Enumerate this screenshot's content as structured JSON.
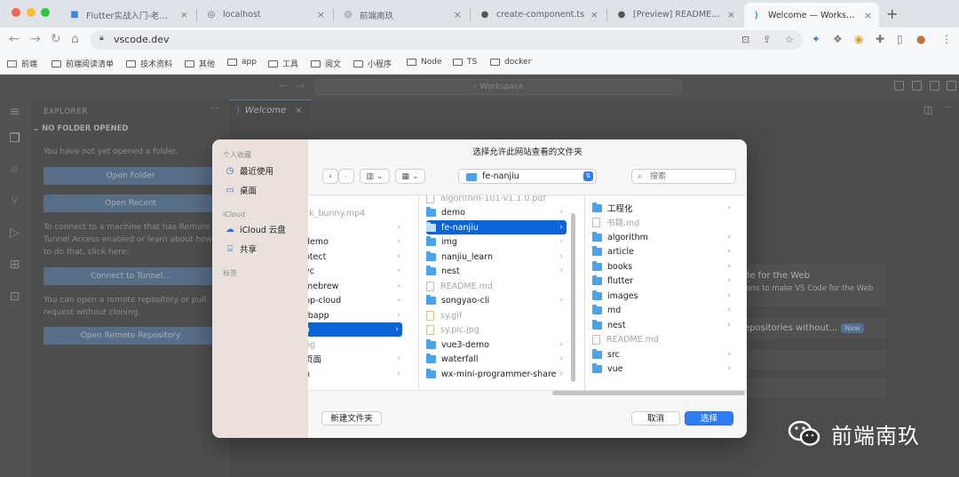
{
  "browser": {
    "tabs": [
      {
        "label": "Flutter实战入门-老孟-前端",
        "icon": "flutter-icon"
      },
      {
        "label": "localhost",
        "icon": "globe-icon"
      },
      {
        "label": "前端南玖",
        "icon": "globe-icon"
      },
      {
        "label": "create-component.ts",
        "icon": "github-icon"
      },
      {
        "label": "[Preview] README.md",
        "icon": "github-icon"
      },
      {
        "label": "Welcome — Workspace",
        "icon": "vscode-icon"
      }
    ],
    "address": "vscode.dev",
    "bookmarks": [
      "前端",
      "前端阅读清单",
      "技术资料",
      "其他",
      "app",
      "工具",
      "阅文",
      "小程序",
      "Node",
      "TS",
      "docker"
    ]
  },
  "vscode": {
    "command_center": "Workspace",
    "explorer_title": "EXPLORER",
    "no_folder_title": "NO FOLDER OPENED",
    "no_folder_text": "You have not yet opened a folder.",
    "open_folder": "Open Folder",
    "open_recent": "Open Recent",
    "tunnel_text": "To connect to a machine that has Remote Tunnel Access enabled or learn about how to do that, click here:",
    "connect_tunnel": "Connect to Tunnel...",
    "remote_text": "You can open a remote repository or pull request without cloning.",
    "open_remote": "Open Remote Repository",
    "welcome_tab": "Welcome",
    "card1_title": "de for the Web",
    "card1_text": "ions to make VS Code for the Web",
    "card2_title": "epositories without...",
    "new_badge": "New"
  },
  "dialog": {
    "title": "选择允许此网站查看的文件夹",
    "sidebar": {
      "favorites_header": "个人收藏",
      "recent": "最近使用",
      "desktop": "桌面",
      "icloud_header": "iCloud",
      "icloud_drive": "iCloud 云盘",
      "shared": "共享",
      "tags_header": "标签"
    },
    "path": "fe-nanjiu",
    "search_placeholder": "搜索",
    "columns": [
      [
        {
          "name": "ck_bunny.mp4",
          "kind": "file"
        },
        {
          "name": "",
          "kind": "folder"
        },
        {
          "name": "demo",
          "kind": "folder"
        },
        {
          "name": "otect",
          "kind": "folder"
        },
        {
          "name": "vc",
          "kind": "folder"
        },
        {
          "name": "mebrew",
          "kind": "folder"
        },
        {
          "name": "pp-cloud",
          "kind": "folder"
        },
        {
          "name": "tbapp",
          "kind": "folder"
        },
        {
          "name": "o",
          "kind": "folder",
          "selected": true
        },
        {
          "name": "ng",
          "kind": "file"
        },
        {
          "name": "页面",
          "kind": "folder"
        },
        {
          "name": "n",
          "kind": "folder"
        }
      ],
      [
        {
          "name": "algorithm-101-v1.1.0.pdf",
          "kind": "file"
        },
        {
          "name": "demo",
          "kind": "folder"
        },
        {
          "name": "fe-nanjiu",
          "kind": "folder",
          "selected": true
        },
        {
          "name": "img",
          "kind": "folder"
        },
        {
          "name": "nanjiu_learn",
          "kind": "folder"
        },
        {
          "name": "nest",
          "kind": "folder"
        },
        {
          "name": "README.md",
          "kind": "file"
        },
        {
          "name": "songyao-cli",
          "kind": "folder"
        },
        {
          "name": "sy.gif",
          "kind": "file"
        },
        {
          "name": "sy.pic.jpg",
          "kind": "file"
        },
        {
          "name": "vue3-demo",
          "kind": "folder"
        },
        {
          "name": "waterfall",
          "kind": "folder"
        },
        {
          "name": "wx-mini-programmer-share",
          "kind": "folder"
        }
      ],
      [
        {
          "name": "工程化",
          "kind": "folder"
        },
        {
          "name": "书籍.md",
          "kind": "file"
        },
        {
          "name": "algorithm",
          "kind": "folder"
        },
        {
          "name": "article",
          "kind": "folder"
        },
        {
          "name": "books",
          "kind": "folder"
        },
        {
          "name": "flutter",
          "kind": "folder"
        },
        {
          "name": "images",
          "kind": "folder"
        },
        {
          "name": "md",
          "kind": "folder"
        },
        {
          "name": "nest",
          "kind": "folder"
        },
        {
          "name": "README.md",
          "kind": "file"
        },
        {
          "name": "src",
          "kind": "folder"
        },
        {
          "name": "vue",
          "kind": "folder"
        }
      ]
    ],
    "new_folder": "新建文件夹",
    "cancel": "取消",
    "choose": "选择"
  },
  "watermark": "前端南玖"
}
